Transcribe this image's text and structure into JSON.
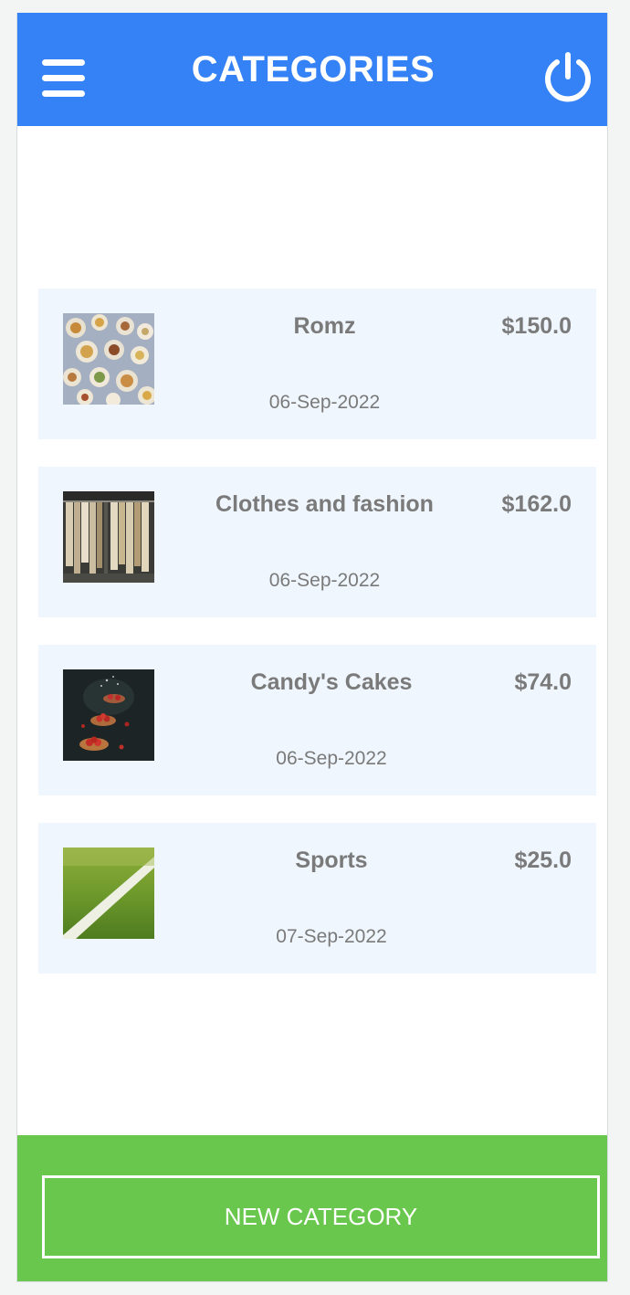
{
  "header": {
    "title": "CATEGORIES",
    "menu_icon": "hamburger-menu-icon",
    "power_icon": "power-icon",
    "background": "#3482f6"
  },
  "categories": [
    {
      "name": "Romz",
      "price": "$150.0",
      "date": "06-Sep-2022",
      "image": "food-platter-image"
    },
    {
      "name": "Clothes and fashion",
      "price": "$162.0",
      "date": "06-Sep-2022",
      "image": "clothes-rack-image"
    },
    {
      "name": "Candy's Cakes",
      "price": "$74.0",
      "date": "06-Sep-2022",
      "image": "cakes-image"
    },
    {
      "name": "Sports",
      "price": "$25.0",
      "date": "07-Sep-2022",
      "image": "grass-field-image"
    }
  ],
  "footer": {
    "new_category_label": "NEW CATEGORY",
    "background": "#68c74c"
  }
}
